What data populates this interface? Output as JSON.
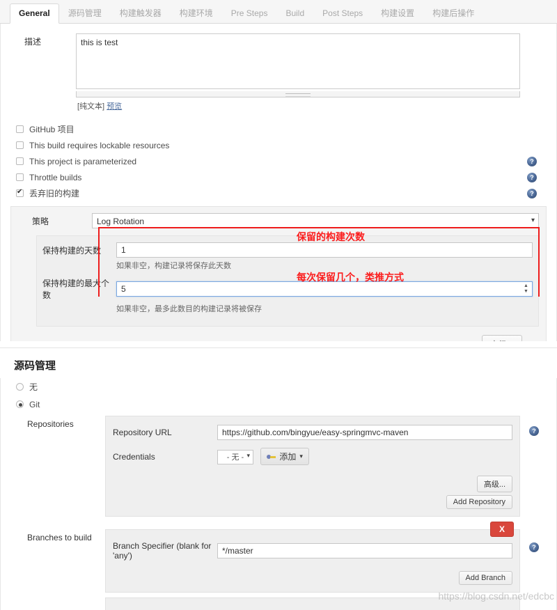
{
  "tabs": [
    {
      "label": "General",
      "active": true
    },
    {
      "label": "源码管理",
      "active": false
    },
    {
      "label": "构建触发器",
      "active": false
    },
    {
      "label": "构建环境",
      "active": false
    },
    {
      "label": "Pre Steps",
      "active": false
    },
    {
      "label": "Build",
      "active": false
    },
    {
      "label": "Post Steps",
      "active": false
    },
    {
      "label": "构建设置",
      "active": false
    },
    {
      "label": "构建后操作",
      "active": false
    }
  ],
  "general": {
    "description_label": "描述",
    "description_value": "this is test",
    "description_placeholder": "",
    "plaintext_label": "[纯文本]",
    "preview_label": "预览",
    "checkboxes": [
      {
        "label": "GitHub 项目",
        "checked": false,
        "help": false
      },
      {
        "label": "This build requires lockable resources",
        "checked": false,
        "help": false
      },
      {
        "label": "This project is parameterized",
        "checked": false,
        "help": true
      },
      {
        "label": "Throttle builds",
        "checked": false,
        "help": true
      },
      {
        "label": "丢弃旧的构建",
        "checked": true,
        "help": true
      }
    ],
    "help_glyph": "?",
    "strategy": {
      "label": "策略",
      "selected": "Log Rotation",
      "options": [
        "Log Rotation"
      ],
      "days_label": "保持构建的天数",
      "days_value": "1",
      "days_help": "如果非空，构建记录将保存此天数",
      "max_label": "保持构建的最大个数",
      "max_value": "5",
      "max_help": "如果非空，最多此数目的构建记录将被保存"
    },
    "advanced_label": "高级...",
    "annotations": [
      {
        "text": "保留的构建次数"
      },
      {
        "text": "每次保留几个，类推方式"
      }
    ]
  },
  "scm": {
    "heading": "源码管理",
    "radios": [
      {
        "label": "无",
        "selected": false
      },
      {
        "label": "Git",
        "selected": true
      }
    ],
    "repositories": {
      "group_label": "Repositories",
      "url_label": "Repository URL",
      "url_value": "https://github.com/bingyue/easy-springmvc-maven",
      "credentials_label": "Credentials",
      "credentials_selected": "- 无 -",
      "credentials_add_label": "添加",
      "advanced_label": "高级...",
      "add_repository_label": "Add Repository"
    },
    "branches": {
      "group_label": "Branches to build",
      "specifier_label": "Branch Specifier (blank for 'any')",
      "specifier_value": "*/master",
      "delete_label": "X",
      "add_branch_label": "Add Branch"
    }
  },
  "watermark": "https://blog.csdn.net/edcbc",
  "colors": {
    "accent_red": "#fb1d1d",
    "help_blue": "#4a6795",
    "delete_red": "#d9473c",
    "focus_blue": "#7aa7e0"
  }
}
